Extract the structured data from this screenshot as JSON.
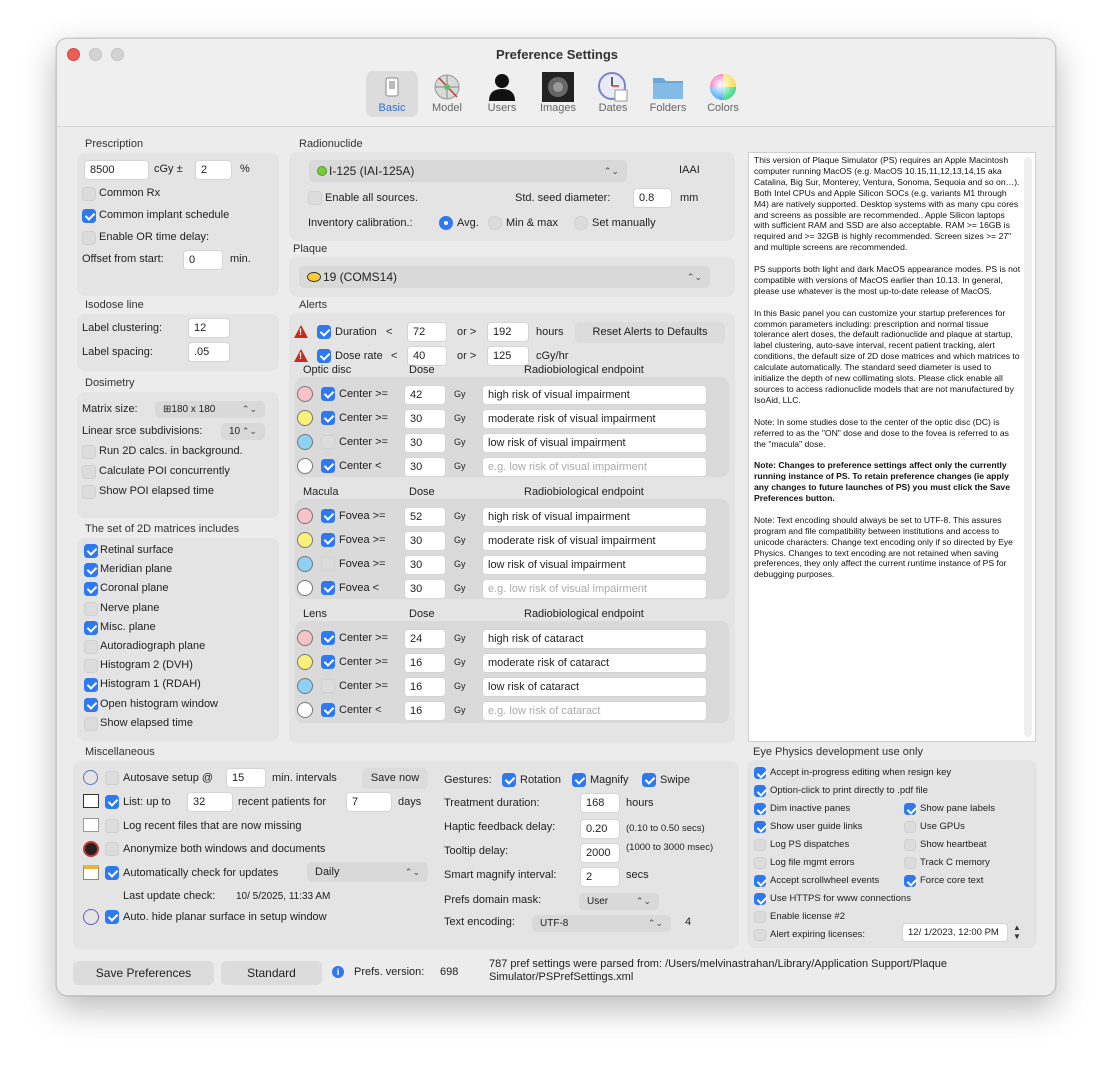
{
  "window": {
    "title": "Preference Settings"
  },
  "toolbar": [
    {
      "label": "Basic",
      "icon": "basic-pane-icon"
    },
    {
      "label": "Model",
      "icon": "model-icon"
    },
    {
      "label": "Users",
      "icon": "user-icon"
    },
    {
      "label": "Images",
      "icon": "images-icon"
    },
    {
      "label": "Dates",
      "icon": "calendar-clock-icon"
    },
    {
      "label": "Folders",
      "icon": "folder-icon"
    },
    {
      "label": "Colors",
      "icon": "color-wheel-icon"
    }
  ],
  "prescription": {
    "heading": "Prescription",
    "dose": "8500",
    "dose_unit": "cGy ±",
    "tol": "2",
    "tol_unit": "%",
    "common_rx": "Common Rx",
    "common_implant": "Common implant schedule",
    "or_delay": "Enable OR time delay:",
    "offset_label": "Offset from start:",
    "offset": "0",
    "offset_unit": "min."
  },
  "isodose": {
    "heading": "Isodose line",
    "clustering_label": "Label clustering:",
    "clustering": "12",
    "spacing_label": "Label spacing:",
    "spacing": ".05"
  },
  "dosimetry": {
    "heading": "Dosimetry",
    "matrix_label": "Matrix size:",
    "matrix": "180 x 180",
    "subdiv_label": "Linear srce subdivisions:",
    "subdiv": "10",
    "bg": "Run 2D calcs. in background.",
    "poi": "Calculate POI concurrently",
    "poi_time": "Show POI elapsed time"
  },
  "matrices": {
    "heading": "The set of 2D matrices includes",
    "items": [
      "Retinal surface",
      "Meridian plane",
      "Coronal plane",
      "Nerve plane",
      "Misc. plane",
      "Autoradiograph plane",
      "Histogram 2 (DVH)",
      "Histogram 1 (RDAH)",
      "Open histogram window",
      "Show elapsed time"
    ]
  },
  "radionuclide": {
    "heading": "Radionuclide",
    "source": "I-125 (IAI-125A)",
    "maker": "IAAI",
    "enable_all": "Enable all sources.",
    "seed_label": "Std. seed diameter:",
    "seed": "0.8",
    "seed_unit": "mm",
    "inv_label": "Inventory calibration.:",
    "opt_avg": "Avg.",
    "opt_minmax": "Min & max",
    "opt_manual": "Set manually"
  },
  "plaque": {
    "heading": "Plaque",
    "value": "19 (COMS14)"
  },
  "alerts": {
    "heading": "Alerts",
    "duration": {
      "label": "Duration",
      "lt": "<",
      "low": "72",
      "or": "or >",
      "high": "192",
      "unit": "hours"
    },
    "rate": {
      "label": "Dose rate",
      "lt": "<",
      "low": "40",
      "or": "or >",
      "high": "125",
      "unit": "cGy/hr"
    },
    "reset": "Reset Alerts to Defaults",
    "dose_col": "Dose",
    "endpoint_col": "Radiobiological endpoint",
    "gy": "Gy",
    "groups": [
      {
        "name": "Optic disc",
        "rows": [
          {
            "label": "Center >=",
            "dose": "42",
            "end": "high risk of visual impairment",
            "color": "#f5c3c8"
          },
          {
            "label": "Center >=",
            "dose": "30",
            "end": "moderate risk of visual impairment",
            "color": "#fbf17a"
          },
          {
            "label": "Center >=",
            "dose": "30",
            "end": "low risk of visual impairment",
            "color": "#8fd0f5"
          },
          {
            "label": "Center <",
            "dose": "30",
            "end": "e.g. low risk of visual impairment",
            "color": "#ffffff"
          }
        ]
      },
      {
        "name": "Macula",
        "rows": [
          {
            "label": "Fovea >=",
            "dose": "52",
            "end": "high risk of visual impairment",
            "color": "#f5c3c8"
          },
          {
            "label": "Fovea >=",
            "dose": "30",
            "end": "moderate risk of visual impairment",
            "color": "#fbf17a"
          },
          {
            "label": "Fovea >=",
            "dose": "30",
            "end": "low risk of visual impairment",
            "color": "#8fd0f5"
          },
          {
            "label": "Fovea <",
            "dose": "30",
            "end": "e.g. low risk of visual impairment",
            "color": "#ffffff"
          }
        ]
      },
      {
        "name": "Lens",
        "rows": [
          {
            "label": "Center >=",
            "dose": "24",
            "end": "high risk of cataract",
            "color": "#f5c3c8"
          },
          {
            "label": "Center >=",
            "dose": "16",
            "end": "moderate risk of cataract",
            "color": "#fbf17a"
          },
          {
            "label": "Center >=",
            "dose": "16",
            "end": "low risk of cataract",
            "color": "#8fd0f5"
          },
          {
            "label": "Center <",
            "dose": "16",
            "end": "e.g. low risk of cataract",
            "color": "#ffffff"
          }
        ]
      }
    ]
  },
  "help_text": [
    "This version of Plaque Simulator (PS) requires an Apple Macintosh computer running MacOS (e.g. MacOS 10.15,11,12,13,14,15 aka Catalina, Big Sur, Monterey, Ventura, Sonoma, Sequoia and so on…). Both Intel CPUs and Apple Silicon SOCs (e.g. variants M1 through M4) are natively supported. Desktop systems with as many cpu cores and screens as possible are recommended.. Apple Silicon laptops with sufficient RAM and SSD are also acceptable. RAM >= 16GB is required and >= 32GB is highly recommended. Screen sizes >= 27\" and multiple screens are recommended.",
    "PS supports both light and dark MacOS appearance modes. PS is not compatible with versions of MacOS earlier than 10.13. In general, please use whatever is the most up-to-date release of MacOS.",
    "In this Basic panel you can customize your startup preferences for common parameters including: prescription and normal tissue tolerance alert doses, the default radionuclide and plaque at startup, label clustering, auto-save interval, recent patient tracking, alert conditions, the default size of 2D dose matrices and which matrices to calculate automatically. The standard seed diameter is used to initialize the depth of new collimating slots. Please click enable all sources to access radionuclide models that are not manufactured by IsoAid, LLC.",
    "Note: In some studies dose to the center of the optic disc (DC) is referred to as the \"ON\" dose and dose to the fovea is referred to as the \"macula\" dose.",
    "Note: Changes to preference settings affect only the currently running instance of PS. To retain preference changes (ie apply any changes to future launches of PS) you must click the Save Preferences button.",
    "Note: Text encoding should always be set to UTF-8. This assures program and file compatibility between institutions and access to unicode characters. Change text encoding only if so directed by Eye Physics. Changes to text encoding are not retained when saving preferences, they only affect the current runtime instance of PS for debugging purposes."
  ],
  "misc": {
    "heading": "Miscellaneous",
    "autosave": "Autosave setup @",
    "autosave_val": "15",
    "autosave_unit": "min. intervals",
    "save_now": "Save now",
    "list": "List: up to",
    "list_val": "32",
    "list_mid": "recent patients for",
    "days_val": "7",
    "days": "days",
    "log_missing": "Log recent files that are now missing",
    "anon": "Anonymize both windows and documents",
    "auto_check": "Automatically check for updates",
    "freq": "Daily",
    "last_label": "Last update check:",
    "last_val": "10/ 5/2025, 11:33 AM",
    "hide_planar": "Auto. hide planar surface in setup window",
    "gestures": "Gestures:",
    "rotation": "Rotation",
    "magnify": "Magnify",
    "swipe": "Swipe",
    "treat_label": "Treatment duration:",
    "treat_val": "168",
    "treat_unit": "hours",
    "haptic_label": "Haptic feedback delay:",
    "haptic_val": "0.20",
    "haptic_note": "(0.10 to 0.50 secs)",
    "tooltip_label": "Tooltip delay:",
    "tooltip_val": "2000",
    "tooltip_note": "(1000 to 3000 msec)",
    "smart_label": "Smart magnify interval:",
    "smart_val": "2",
    "smart_unit": "secs",
    "domain_label": "Prefs domain mask:",
    "domain_val": "User",
    "enc_label": "Text encoding:",
    "enc_val": "UTF-8",
    "enc_num": "4"
  },
  "dev": {
    "heading": "Eye Physics development use only",
    "accept_edit": "Accept in-progress editing when resign key",
    "opt_click": "Option-click to print directly to .pdf file",
    "dim": "Dim inactive panes",
    "pane_labels": "Show pane labels",
    "guide": "Show user guide links",
    "gpus": "Use GPUs",
    "dispatches": "Log PS dispatches",
    "heartbeat": "Show heartbeat",
    "mgmt": "Log file mgmt errors",
    "cmem": "Track C memory",
    "scroll": "Accept scrollwheel events",
    "core": "Force core text",
    "https": "Use HTTPS for www connections",
    "license": "Enable license #2",
    "expiring": "Alert expiring licenses:",
    "expiring_val": "12/  1/2023, 12:00 PM"
  },
  "footer": {
    "save": "Save Preferences",
    "standard": "Standard",
    "version_label": "Prefs. version:",
    "version": "698",
    "parsed": "787 pref settings were parsed from: /Users/melvinastrahan/Library/Application Support/Plaque Simulator/PSPrefSettings.xml"
  }
}
